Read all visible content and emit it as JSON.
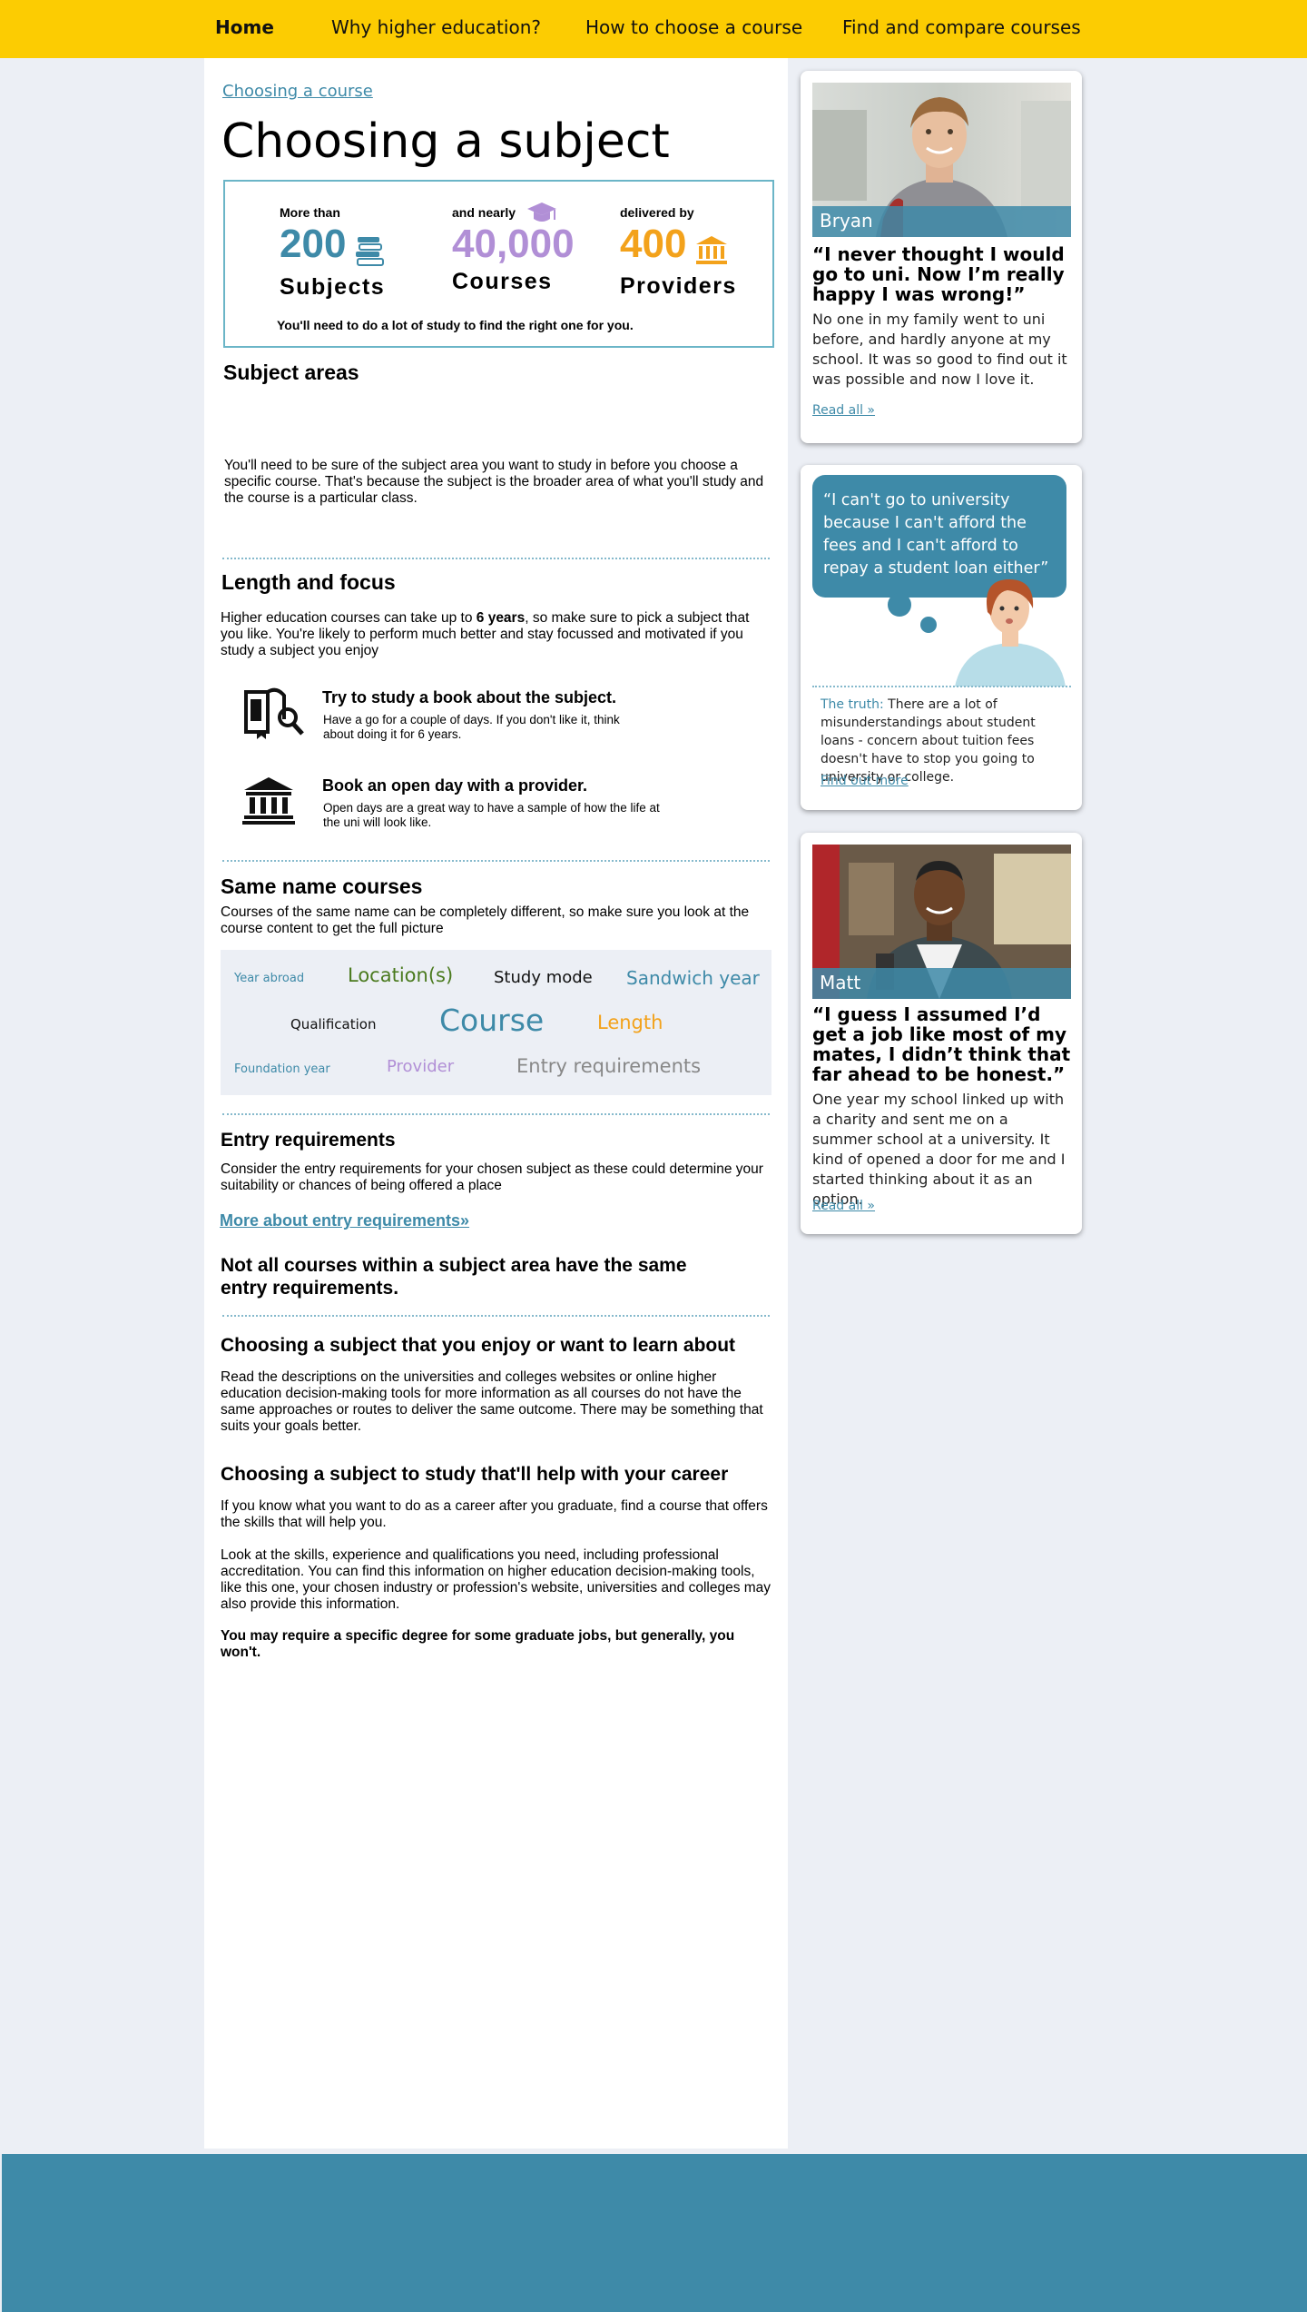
{
  "nav": {
    "items": [
      {
        "label": "Home"
      },
      {
        "label": "Why higher education?"
      },
      {
        "label": "How to choose a course"
      },
      {
        "label": "Find and compare courses"
      }
    ]
  },
  "breadcrumb": "Choosing a course",
  "page_title": "Choosing a subject",
  "stats": [
    {
      "pre": "More than",
      "number": "200",
      "label": "Subjects",
      "color": "#3e8aa8",
      "icon": "books-icon"
    },
    {
      "pre": "and nearly",
      "number": "40,000",
      "label": "Courses",
      "color": "#b18fd6",
      "icon": "graduation-cap-icon"
    },
    {
      "pre": "delivered by",
      "number": "400",
      "label": "Providers",
      "color": "#f3a21b",
      "icon": "institution-icon"
    }
  ],
  "stats_note": "You'll need to do a lot of study to find the right one for you.",
  "subject_areas": {
    "heading": "Subject areas",
    "text": "You'll need to be sure of the subject area you want to study in before you choose a specific course. That's because the subject is the broader area of what you'll study and the course is a particular class."
  },
  "length_focus": {
    "heading": "Length and focus",
    "text_before": "Higher education courses can take up to ",
    "text_bold": "6 years",
    "text_after": ", so make sure to pick a subject that you like. You're likely to perform much better and stay focussed and motivated if you study a subject you enjoy",
    "tips": [
      {
        "title": "Try to study a book about the subject.",
        "body": "Have a go for a couple of days. If you don't like it, think about doing it for 6 years.",
        "icon": "book-magnifier-icon"
      },
      {
        "title": "Book an open day with a provider.",
        "body": "Open days are a great way to have a sample of how the life at the uni will look like.",
        "icon": "institution-icon"
      }
    ]
  },
  "same_name": {
    "heading": "Same name courses",
    "text": "Courses of the same name can be completely different, so make sure you look at the course content to get the full picture",
    "tags": [
      {
        "label": "Year abroad",
        "color": "#3e8aa8"
      },
      {
        "label": "Location(s)",
        "color": "#4a7a1e"
      },
      {
        "label": "Study mode",
        "color": "#111111"
      },
      {
        "label": "Sandwich year",
        "color": "#3e8aa8"
      },
      {
        "label": "Qualification",
        "color": "#111111"
      },
      {
        "label": "Course",
        "color": "#3e8aa8"
      },
      {
        "label": "Length",
        "color": "#f3a21b"
      },
      {
        "label": "Foundation year",
        "color": "#3e8aa8"
      },
      {
        "label": "Provider",
        "color": "#b18fd6"
      },
      {
        "label": "Entry requirements",
        "color": "#888888"
      }
    ]
  },
  "entry": {
    "heading": "Entry requirements",
    "text": "Consider the entry requirements for your chosen subject as these could determine your suitability or chances of being offered a place",
    "link": "More about entry requirements»",
    "callout": "Not all courses within a subject area have the same entry requirements."
  },
  "enjoy": {
    "heading": "Choosing a subject that you enjoy or want to learn about",
    "text": "Read the descriptions on the universities and colleges websites or online higher education decision-making tools for more information as all courses do not have the same approaches or routes to deliver the same outcome.  There may be something that suits your goals better."
  },
  "career": {
    "heading": "Choosing a subject to study that'll help with your career",
    "text1": "If you know what you want to do as a career after you graduate, find a course that offers the skills that will help you.",
    "text2": "Look at the skills, experience and qualifications you need, including professional accreditation. You can find this information on higher education decision-making tools, like this one, your chosen industry or profession's website, universities and colleges may also provide this information.",
    "text3": "You may require a specific degree for some graduate jobs, but generally, you won't."
  },
  "sidebar": {
    "bryan": {
      "name": "Bryan",
      "quote": "“I never thought I would go to uni. Now I’m really happy I was wrong!”",
      "body": "No one in my family went to uni before, and hardly anyone at my school. It was so good to find out it was possible and now I love it.",
      "link": "Read all »"
    },
    "myth": {
      "bubble": "“I can't go to university because I can't afford the fees and I can't afford to repay a student loan either”",
      "truth_label": "The truth:",
      "truth_text": " There are a lot of misunderstandings about student loans - concern about tuition fees doesn't have to stop you going to university or college.",
      "link": "Find out more"
    },
    "matt": {
      "name": "Matt",
      "quote": "“I guess I assumed I’d get a job like most of my mates, I didn’t think that far ahead to be honest.”",
      "body": "One year my school linked up with a charity and sent me on a summer school at a university. It kind of opened a door for me and I started thinking about it as an option.",
      "link": "Read all »"
    }
  }
}
